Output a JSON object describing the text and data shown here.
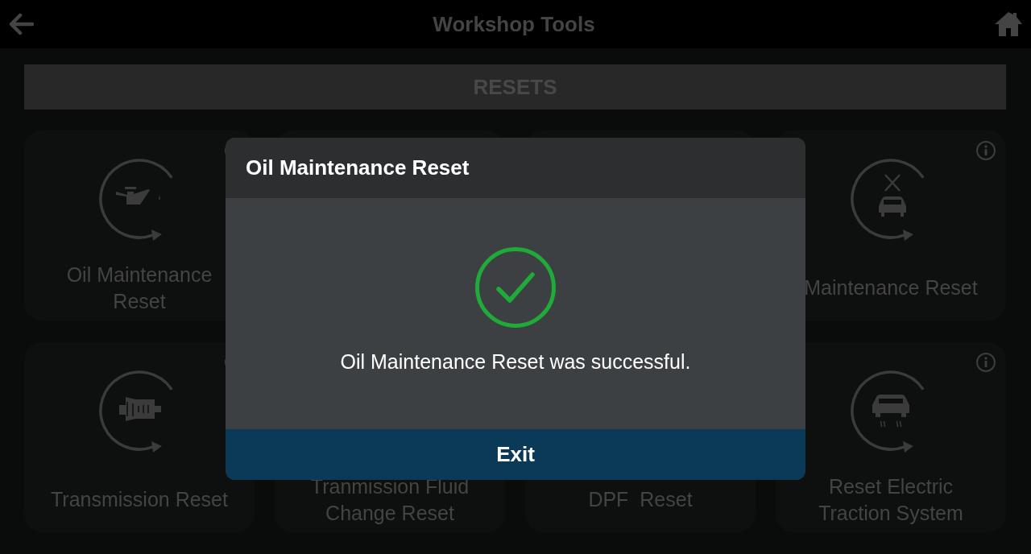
{
  "header": {
    "title": "Workshop Tools"
  },
  "section": {
    "title": "RESETS"
  },
  "cards": [
    {
      "kind": "oil",
      "label": "Oil Maintenance Reset",
      "info": true
    },
    {
      "kind": "hidden",
      "info": false
    },
    {
      "kind": "hidden",
      "info": false
    },
    {
      "kind": "service",
      "label": "Maintenance Reset",
      "info": true
    },
    {
      "kind": "transmission",
      "label": "Transmission Reset",
      "info": true
    },
    {
      "kind": "hidden",
      "label": "Tranmission Fluid Change Reset",
      "info": false
    },
    {
      "kind": "hidden",
      "label": "DPF  Reset",
      "info": false
    },
    {
      "kind": "traction",
      "label": "Reset Electric Traction System",
      "info": true
    }
  ],
  "dialog": {
    "title": "Oil Maintenance Reset",
    "kind": "success",
    "message": "Oil Maintenance Reset was successful.",
    "button": "Exit"
  }
}
